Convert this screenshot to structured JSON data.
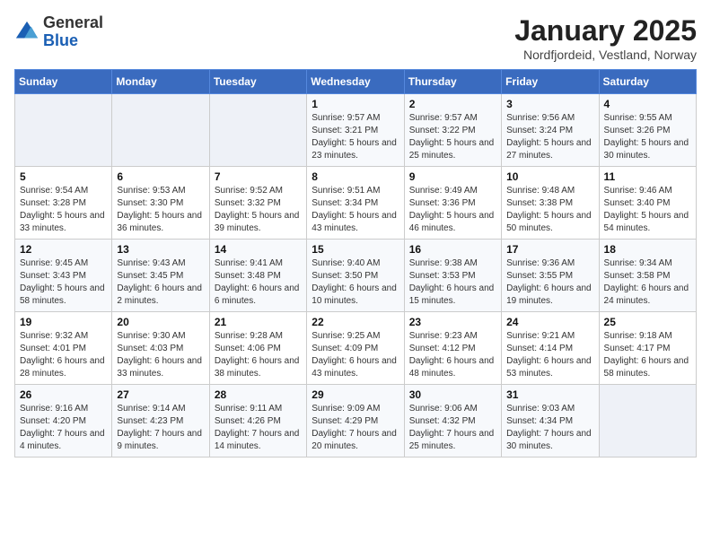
{
  "logo": {
    "general": "General",
    "blue": "Blue"
  },
  "header": {
    "month": "January 2025",
    "location": "Nordfjordeid, Vestland, Norway"
  },
  "weekdays": [
    "Sunday",
    "Monday",
    "Tuesday",
    "Wednesday",
    "Thursday",
    "Friday",
    "Saturday"
  ],
  "weeks": [
    [
      {
        "day": "",
        "info": ""
      },
      {
        "day": "",
        "info": ""
      },
      {
        "day": "",
        "info": ""
      },
      {
        "day": "1",
        "info": "Sunrise: 9:57 AM\nSunset: 3:21 PM\nDaylight: 5 hours and 23 minutes."
      },
      {
        "day": "2",
        "info": "Sunrise: 9:57 AM\nSunset: 3:22 PM\nDaylight: 5 hours and 25 minutes."
      },
      {
        "day": "3",
        "info": "Sunrise: 9:56 AM\nSunset: 3:24 PM\nDaylight: 5 hours and 27 minutes."
      },
      {
        "day": "4",
        "info": "Sunrise: 9:55 AM\nSunset: 3:26 PM\nDaylight: 5 hours and 30 minutes."
      }
    ],
    [
      {
        "day": "5",
        "info": "Sunrise: 9:54 AM\nSunset: 3:28 PM\nDaylight: 5 hours and 33 minutes."
      },
      {
        "day": "6",
        "info": "Sunrise: 9:53 AM\nSunset: 3:30 PM\nDaylight: 5 hours and 36 minutes."
      },
      {
        "day": "7",
        "info": "Sunrise: 9:52 AM\nSunset: 3:32 PM\nDaylight: 5 hours and 39 minutes."
      },
      {
        "day": "8",
        "info": "Sunrise: 9:51 AM\nSunset: 3:34 PM\nDaylight: 5 hours and 43 minutes."
      },
      {
        "day": "9",
        "info": "Sunrise: 9:49 AM\nSunset: 3:36 PM\nDaylight: 5 hours and 46 minutes."
      },
      {
        "day": "10",
        "info": "Sunrise: 9:48 AM\nSunset: 3:38 PM\nDaylight: 5 hours and 50 minutes."
      },
      {
        "day": "11",
        "info": "Sunrise: 9:46 AM\nSunset: 3:40 PM\nDaylight: 5 hours and 54 minutes."
      }
    ],
    [
      {
        "day": "12",
        "info": "Sunrise: 9:45 AM\nSunset: 3:43 PM\nDaylight: 5 hours and 58 minutes."
      },
      {
        "day": "13",
        "info": "Sunrise: 9:43 AM\nSunset: 3:45 PM\nDaylight: 6 hours and 2 minutes."
      },
      {
        "day": "14",
        "info": "Sunrise: 9:41 AM\nSunset: 3:48 PM\nDaylight: 6 hours and 6 minutes."
      },
      {
        "day": "15",
        "info": "Sunrise: 9:40 AM\nSunset: 3:50 PM\nDaylight: 6 hours and 10 minutes."
      },
      {
        "day": "16",
        "info": "Sunrise: 9:38 AM\nSunset: 3:53 PM\nDaylight: 6 hours and 15 minutes."
      },
      {
        "day": "17",
        "info": "Sunrise: 9:36 AM\nSunset: 3:55 PM\nDaylight: 6 hours and 19 minutes."
      },
      {
        "day": "18",
        "info": "Sunrise: 9:34 AM\nSunset: 3:58 PM\nDaylight: 6 hours and 24 minutes."
      }
    ],
    [
      {
        "day": "19",
        "info": "Sunrise: 9:32 AM\nSunset: 4:01 PM\nDaylight: 6 hours and 28 minutes."
      },
      {
        "day": "20",
        "info": "Sunrise: 9:30 AM\nSunset: 4:03 PM\nDaylight: 6 hours and 33 minutes."
      },
      {
        "day": "21",
        "info": "Sunrise: 9:28 AM\nSunset: 4:06 PM\nDaylight: 6 hours and 38 minutes."
      },
      {
        "day": "22",
        "info": "Sunrise: 9:25 AM\nSunset: 4:09 PM\nDaylight: 6 hours and 43 minutes."
      },
      {
        "day": "23",
        "info": "Sunrise: 9:23 AM\nSunset: 4:12 PM\nDaylight: 6 hours and 48 minutes."
      },
      {
        "day": "24",
        "info": "Sunrise: 9:21 AM\nSunset: 4:14 PM\nDaylight: 6 hours and 53 minutes."
      },
      {
        "day": "25",
        "info": "Sunrise: 9:18 AM\nSunset: 4:17 PM\nDaylight: 6 hours and 58 minutes."
      }
    ],
    [
      {
        "day": "26",
        "info": "Sunrise: 9:16 AM\nSunset: 4:20 PM\nDaylight: 7 hours and 4 minutes."
      },
      {
        "day": "27",
        "info": "Sunrise: 9:14 AM\nSunset: 4:23 PM\nDaylight: 7 hours and 9 minutes."
      },
      {
        "day": "28",
        "info": "Sunrise: 9:11 AM\nSunset: 4:26 PM\nDaylight: 7 hours and 14 minutes."
      },
      {
        "day": "29",
        "info": "Sunrise: 9:09 AM\nSunset: 4:29 PM\nDaylight: 7 hours and 20 minutes."
      },
      {
        "day": "30",
        "info": "Sunrise: 9:06 AM\nSunset: 4:32 PM\nDaylight: 7 hours and 25 minutes."
      },
      {
        "day": "31",
        "info": "Sunrise: 9:03 AM\nSunset: 4:34 PM\nDaylight: 7 hours and 30 minutes."
      },
      {
        "day": "",
        "info": ""
      }
    ]
  ]
}
